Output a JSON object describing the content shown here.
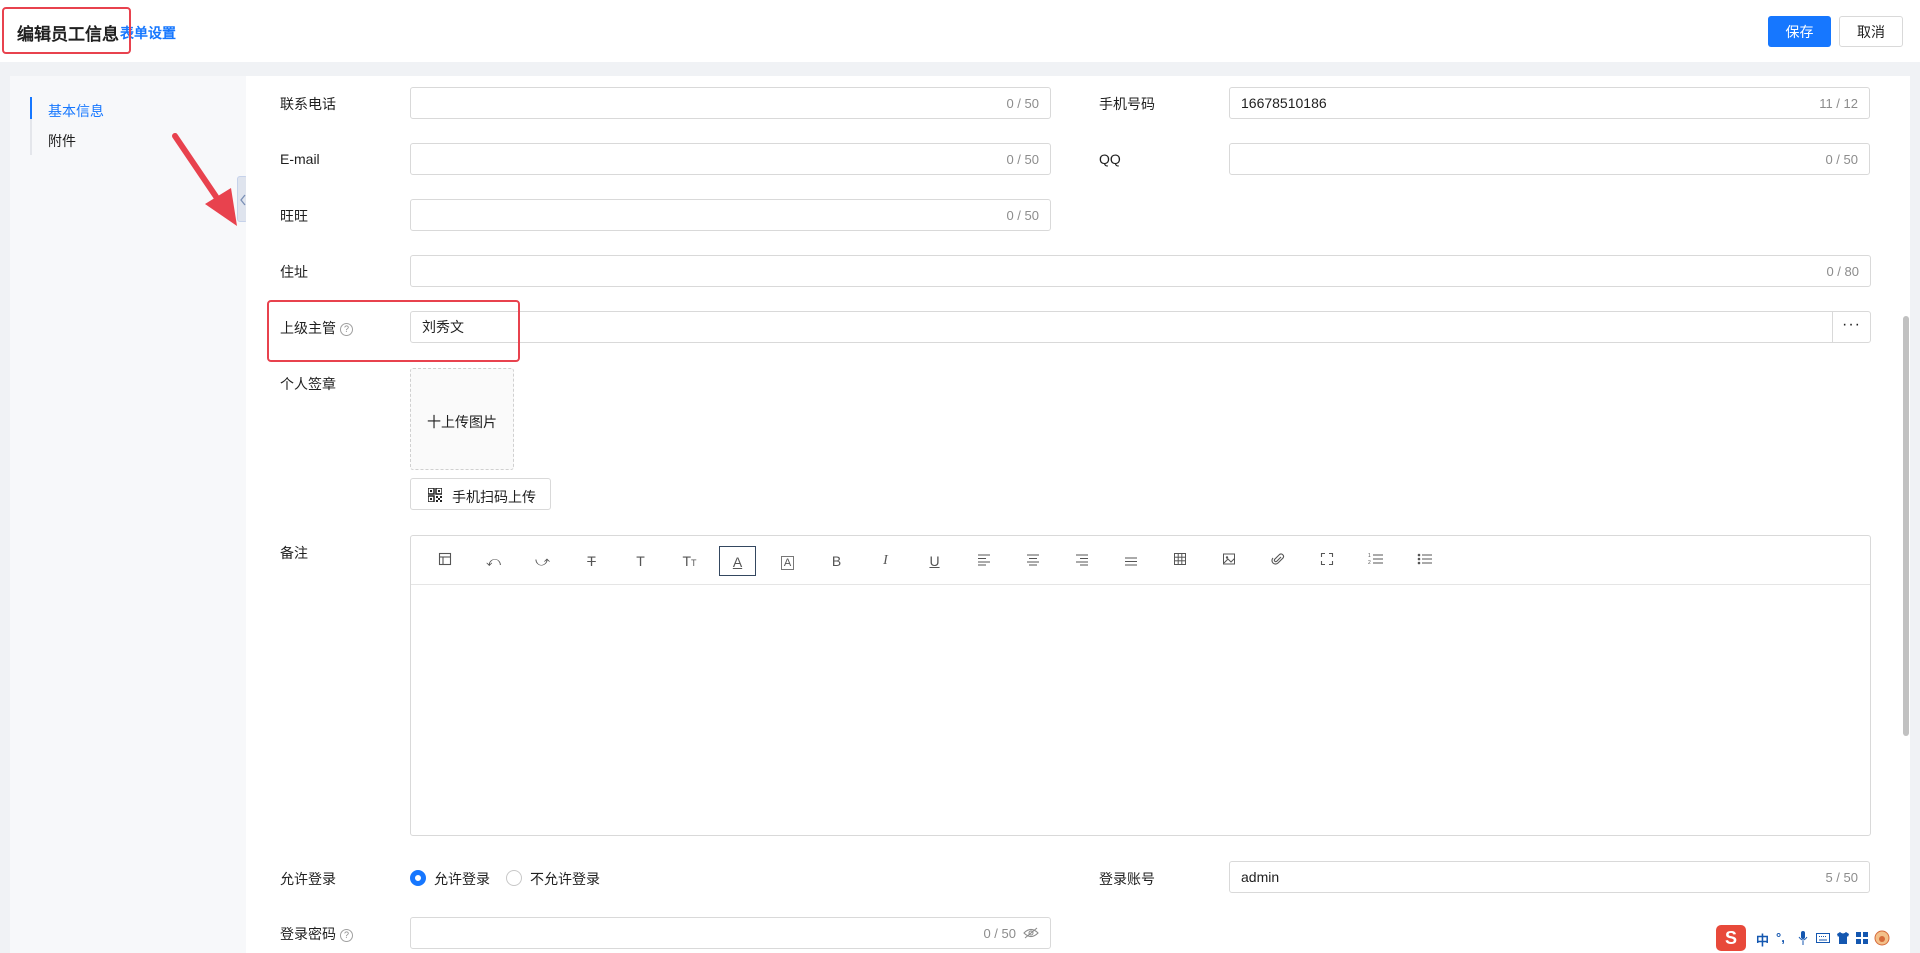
{
  "header": {
    "title": "编辑员工信息",
    "form_settings": "表单设置",
    "save": "保存",
    "cancel": "取消"
  },
  "nav": {
    "items": [
      {
        "label": "基本信息",
        "active": true
      },
      {
        "label": "附件",
        "active": false
      }
    ]
  },
  "form": {
    "contact_phone": {
      "label": "联系电话",
      "value": "",
      "count": "0 / 50"
    },
    "mobile": {
      "label": "手机号码",
      "value": "16678510186",
      "count": "11 / 12"
    },
    "email": {
      "label": "E-mail",
      "value": "",
      "count": "0 / 50"
    },
    "qq": {
      "label": "QQ",
      "value": "",
      "count": "0 / 50"
    },
    "wangwang": {
      "label": "旺旺",
      "value": "",
      "count": "0 / 50"
    },
    "address": {
      "label": "住址",
      "value": "",
      "count": "0 / 80"
    },
    "supervisor": {
      "label": "上级主管",
      "value": "刘秀文",
      "more": "···"
    },
    "signature": {
      "label": "个人签章",
      "upload": "十上传图片",
      "scan_upload": "手机扫码上传"
    },
    "remarks": {
      "label": "备注",
      "toolbar": [
        "layout-icon",
        "undo-icon",
        "redo-icon",
        "strikethrough-icon",
        "text-icon",
        "font-size-icon",
        "font-color-icon",
        "background-color-icon",
        "bold-icon",
        "italic-icon",
        "underline-icon",
        "align-left-icon",
        "align-center-icon",
        "align-right-icon",
        "align-justify-icon",
        "table-icon",
        "image-icon",
        "attachment-icon",
        "fullscreen-icon",
        "ordered-list-icon",
        "unordered-list-icon"
      ]
    },
    "allow_login": {
      "label": "允许登录",
      "options": [
        "允许登录",
        "不允许登录"
      ],
      "selected": "允许登录"
    },
    "login_account": {
      "label": "登录账号",
      "value": "admin",
      "count": "5 / 50"
    },
    "login_password": {
      "label": "登录密码",
      "value": "",
      "count": "0 / 50"
    }
  },
  "ime": {
    "logo": "S",
    "mode": "中",
    "punct": "°,"
  },
  "colors": {
    "primary": "#1677ff",
    "annotation": "#e8424e"
  }
}
